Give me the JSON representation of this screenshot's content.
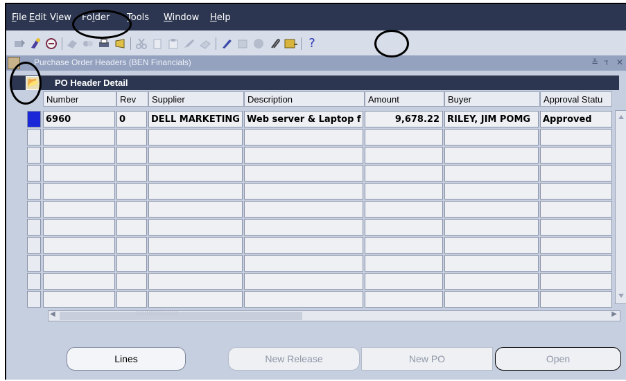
{
  "menubar": {
    "items": [
      {
        "pre": "",
        "acc": "F",
        "post": "ile"
      },
      {
        "pre": "",
        "acc": "E",
        "post": "dit"
      },
      {
        "pre": "V",
        "acc": "i",
        "post": "ew"
      },
      {
        "pre": "Fo",
        "acc": "l",
        "post": "der"
      },
      {
        "pre": "",
        "acc": "T",
        "post": "ools"
      },
      {
        "pre": "",
        "acc": "W",
        "post": "indow"
      },
      {
        "pre": "",
        "acc": "H",
        "post": "elp"
      }
    ]
  },
  "toolbar": {
    "icons": [
      "new-icon",
      "find-icon",
      "navigator-icon",
      "save-icon",
      "switch-responsibility-icon",
      "print-icon",
      "close-form-icon",
      "cut-icon",
      "copy-icon",
      "paste-icon",
      "edit-field-icon",
      "clear-record-icon",
      "attachments-icon",
      "folder-tools-icon",
      "translations-icon",
      "zoom-icon",
      "attachment-paperclip-icon",
      "help-icon"
    ],
    "help_glyph": "?"
  },
  "window": {
    "title": "Purchase Order Headers (BEN Financials)",
    "controls": [
      "≚",
      "ד",
      "✕"
    ]
  },
  "region": {
    "title": "PO Header Detail",
    "folder_glyph": "📂"
  },
  "table": {
    "headers": [
      "Number",
      "Rev",
      "Supplier",
      "Description",
      "Amount",
      "Buyer",
      "Approval Statu"
    ],
    "rows": [
      [
        "6960",
        "0",
        "DELL MARKETING",
        "Web server & Laptop f",
        "9,678.22",
        "RILEY, JIM POMG",
        "Approved"
      ]
    ],
    "empty_rows": 10
  },
  "scroll": {
    "h_thumb_text": "::::::::::::::::::::",
    "left_arrow": "◀",
    "right_arrow": "▶"
  },
  "buttons": {
    "lines": "Lines",
    "new_release": "New Release",
    "new_po": "New PO",
    "open": "Open"
  },
  "colors": {
    "menubar": "#2c3650",
    "background": "#c6cfdf",
    "selected_row_marker": "#1a28d8"
  }
}
